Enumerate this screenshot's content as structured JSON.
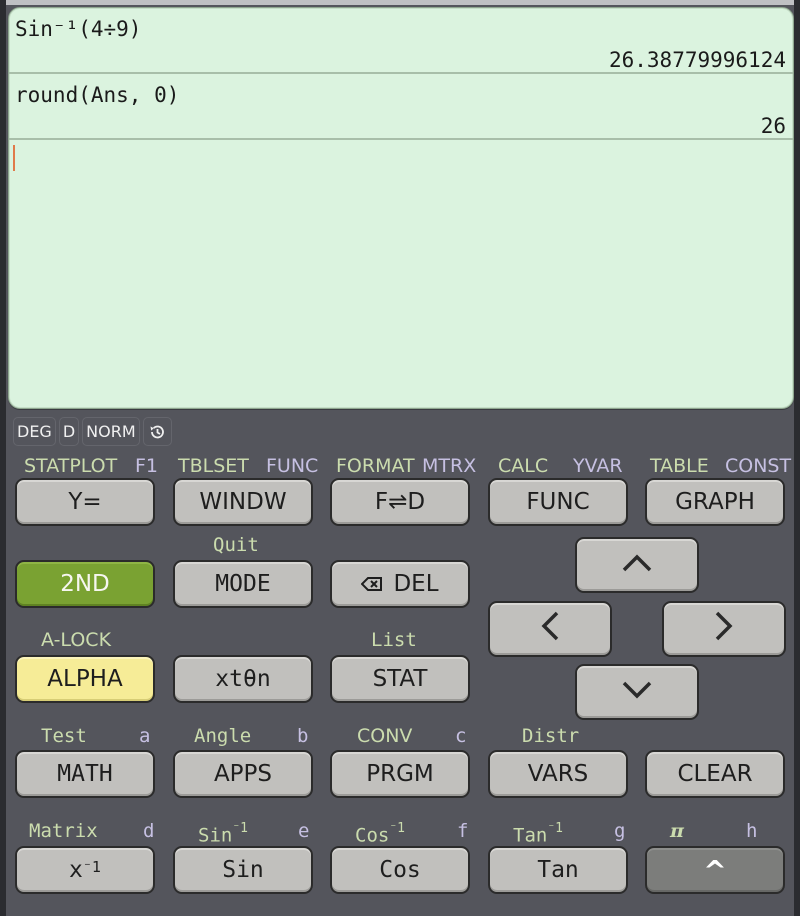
{
  "display": {
    "history": [
      {
        "expression": "Sin⁻¹(4÷9)",
        "result": "26.38779996124"
      },
      {
        "expression": "round(Ans, 0)",
        "result": "26"
      }
    ],
    "current_input": ""
  },
  "status": {
    "angle_mode": "DEG",
    "decimal_mode": "D",
    "format_mode": "NORM",
    "history_icon": "history-icon"
  },
  "keys": {
    "row1": [
      {
        "label": "Y=",
        "second": "STATPLOT",
        "alpha": "F1"
      },
      {
        "label": "WINDW",
        "second": "TBLSET",
        "alpha": "FUNC"
      },
      {
        "label": "F⇌D",
        "second": "FORMAT",
        "alpha": "MTRX"
      },
      {
        "label": "FUNC",
        "second": "CALC",
        "alpha": "YVAR"
      },
      {
        "label": "GRAPH",
        "second": "TABLE",
        "alpha": "CONST"
      }
    ],
    "second": {
      "label": "2ND"
    },
    "mode": {
      "label": "MODE",
      "second": "Quit"
    },
    "del": {
      "label": "DEL",
      "icon": "backspace-icon"
    },
    "alpha": {
      "label": "ALPHA",
      "second": "A-LOCK"
    },
    "xton": {
      "label": "xtθn"
    },
    "stat": {
      "label": "STAT",
      "second": "List"
    },
    "arrows": {
      "up": "up-arrow-icon",
      "left": "left-arrow-icon",
      "right": "right-arrow-icon",
      "down": "down-arrow-icon"
    },
    "row4": [
      {
        "label": "MATH",
        "second": "Test",
        "alpha": "a"
      },
      {
        "label": "APPS",
        "second": "Angle",
        "alpha": "b"
      },
      {
        "label": "PRGM",
        "second": "CONV",
        "alpha": "c"
      },
      {
        "label": "VARS",
        "second": "Distr",
        "alpha": ""
      },
      {
        "label": "CLEAR",
        "second": "",
        "alpha": ""
      }
    ],
    "row5": [
      {
        "label": "x",
        "label_sup": "⁻1",
        "second": "Matrix",
        "alpha": "d"
      },
      {
        "label": "Sin",
        "second": "Sin",
        "second_sup": "⁻1",
        "alpha": "e"
      },
      {
        "label": "Cos",
        "second": "Cos",
        "second_sup": "⁻1",
        "alpha": "f"
      },
      {
        "label": "Tan",
        "second": "Tan",
        "second_sup": "⁻1",
        "alpha": "g"
      },
      {
        "label": "^",
        "second": "π",
        "alpha": "h"
      }
    ]
  }
}
